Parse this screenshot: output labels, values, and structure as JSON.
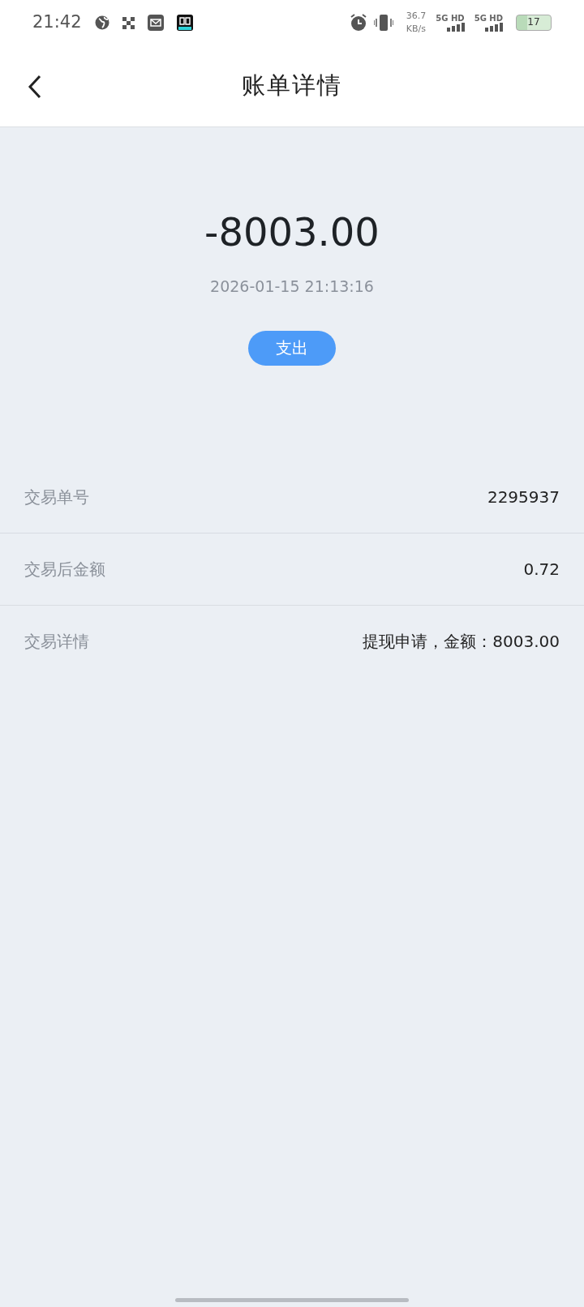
{
  "status_bar": {
    "time": "21:42",
    "speed_value": "36.7",
    "speed_unit": "KB/s",
    "networks": [
      "5G HD",
      "5G HD"
    ],
    "battery": "17"
  },
  "header": {
    "title": "账单详情"
  },
  "summary": {
    "amount": "-8003.00",
    "datetime": "2026-01-15 21:13:16",
    "type_tag": "支出"
  },
  "details": [
    {
      "label": "交易单号",
      "value": "2295937"
    },
    {
      "label": "交易后金额",
      "value": "0.72"
    },
    {
      "label": "交易详情",
      "value": "提现申请，金额：8003.00"
    }
  ]
}
